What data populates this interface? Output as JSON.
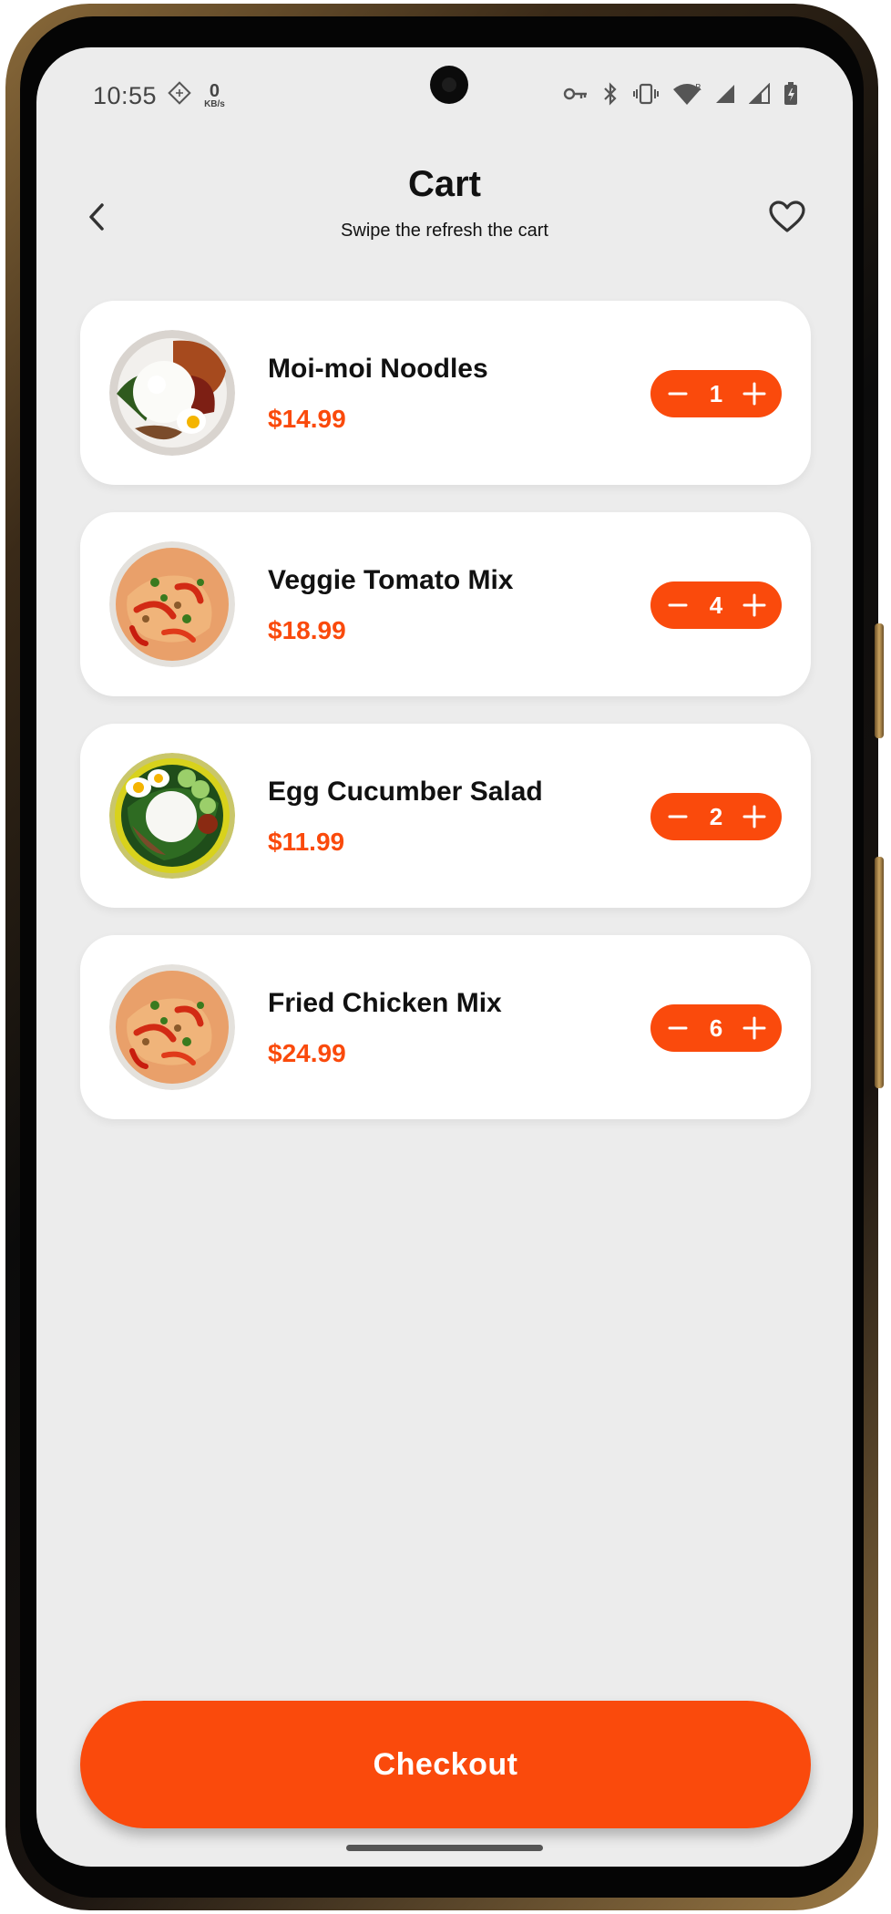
{
  "status_bar": {
    "time": "10:55",
    "net_speed_value": "0",
    "net_speed_unit": "KB/s",
    "icons": [
      "data-saver-icon",
      "key-icon",
      "bluetooth-icon",
      "vibrate-icon",
      "wifi-icon",
      "signal-icon",
      "signal-icon",
      "battery-icon"
    ]
  },
  "header": {
    "title": "Cart",
    "subtitle": "Swipe the refresh the cart",
    "back_icon": "chevron-left-icon",
    "favorite_icon": "heart-icon"
  },
  "cart": {
    "items": [
      {
        "name": "Moi-moi Noodles",
        "price": "$14.99",
        "quantity": "1",
        "image": "rice-plate-with-egg-and-chicken"
      },
      {
        "name": "Veggie Tomato Mix",
        "price": "$18.99",
        "quantity": "4",
        "image": "stir-fried-noodles-with-peppers"
      },
      {
        "name": "Egg Cucumber Salad",
        "price": "$11.99",
        "quantity": "2",
        "image": "rice-plate-on-green-plate"
      },
      {
        "name": "Fried Chicken Mix",
        "price": "$24.99",
        "quantity": "6",
        "image": "stir-fried-noodles-with-peppers"
      }
    ]
  },
  "checkout": {
    "label": "Checkout"
  },
  "colors": {
    "accent": "#FA4A0C",
    "background": "#ECECEC",
    "card": "#FFFFFF",
    "text": "#111111"
  }
}
